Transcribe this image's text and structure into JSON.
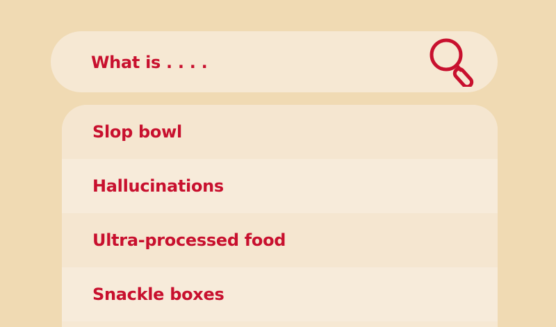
{
  "search": {
    "text": "What is . . . .",
    "icon": "magnifier-icon"
  },
  "results": [
    {
      "label": "Slop bowl"
    },
    {
      "label": "Hallucinations"
    },
    {
      "label": "Ultra-processed food"
    },
    {
      "label": "Snackle boxes"
    }
  ],
  "colors": {
    "background": "#F0DAB3",
    "panel": "#F6E8D3",
    "accent": "#C8102E"
  }
}
